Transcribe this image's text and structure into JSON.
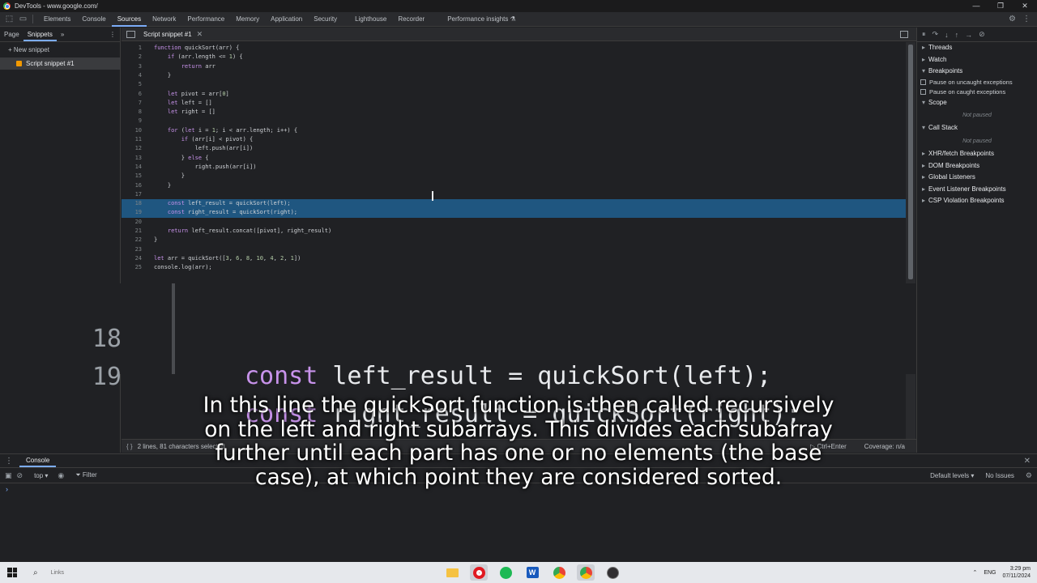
{
  "window": {
    "title": "DevTools - www.google.com/",
    "controls": [
      "—",
      "❐",
      "✕"
    ]
  },
  "maintabs": [
    "Elements",
    "Console",
    "Sources",
    "Network",
    "Performance",
    "Memory",
    "Application",
    "Security",
    "Lighthouse",
    "Recorder",
    "Performance insights ⚗"
  ],
  "navigator": {
    "tabs": [
      "Page",
      "Snippets"
    ],
    "more": "»",
    "new_snippet": "+ New snippet",
    "snippet": "Script snippet #1"
  },
  "editor": {
    "tab": "Script snippet #1",
    "close": "✕"
  },
  "code": [
    {
      "n": "1",
      "t": "function quickSort(arr) {"
    },
    {
      "n": "2",
      "t": "    if (arr.length <= 1) {"
    },
    {
      "n": "3",
      "t": "        return arr"
    },
    {
      "n": "4",
      "t": "    }"
    },
    {
      "n": "5",
      "t": ""
    },
    {
      "n": "6",
      "t": "    let pivot = arr[0]"
    },
    {
      "n": "7",
      "t": "    let left = []"
    },
    {
      "n": "8",
      "t": "    let right = []"
    },
    {
      "n": "9",
      "t": ""
    },
    {
      "n": "10",
      "t": "    for (let i = 1; i < arr.length; i++) {"
    },
    {
      "n": "11",
      "t": "        if (arr[i] < pivot) {"
    },
    {
      "n": "12",
      "t": "            left.push(arr[i])"
    },
    {
      "n": "13",
      "t": "        } else {"
    },
    {
      "n": "14",
      "t": "            right.push(arr[i])"
    },
    {
      "n": "15",
      "t": "        }"
    },
    {
      "n": "16",
      "t": "    }"
    },
    {
      "n": "17",
      "t": ""
    },
    {
      "n": "18",
      "t": "    const left_result = quickSort(left);"
    },
    {
      "n": "19",
      "t": "    const right_result = quickSort(right);"
    },
    {
      "n": "20",
      "t": ""
    },
    {
      "n": "21",
      "t": "    return left_result.concat([pivot], right_result)"
    },
    {
      "n": "22",
      "t": "}"
    },
    {
      "n": "23",
      "t": ""
    },
    {
      "n": "24",
      "t": "let arr = quickSort([3, 6, 8, 10, 4, 2, 1])"
    },
    {
      "n": "25",
      "t": "console.log(arr);"
    }
  ],
  "selected_lines": [
    "18",
    "19"
  ],
  "zoom": [
    {
      "n": "18",
      "kw": "const",
      "rest": " left_result = quickSort(left);"
    },
    {
      "n": "19",
      "kw": "const",
      "rest": " right_result = quickSort(right);"
    }
  ],
  "status": {
    "braces": "{ }",
    "selection": "2 lines, 81 characters selected",
    "run": "▷ Ctrl+Enter",
    "coverage": "Coverage: n/a"
  },
  "debugger": {
    "threads": "Threads",
    "watch": "Watch",
    "breakpoints": "Breakpoints",
    "pause_uncaught": "Pause on uncaught exceptions",
    "pause_caught": "Pause on caught exceptions",
    "scope": "Scope",
    "not_paused": "Not paused",
    "call_stack": "Call Stack",
    "xhr": "XHR/fetch Breakpoints",
    "dom": "DOM Breakpoints",
    "global": "Global Listeners",
    "event": "Event Listener Breakpoints",
    "csp": "CSP Violation Breakpoints"
  },
  "console": {
    "tab": "Console",
    "context": "top ▾",
    "filter": "Filter",
    "levels": "Default levels ▾",
    "issues": "No Issues",
    "prompt": "›"
  },
  "caption": "In this line the quickSort function is then called recursively on the left and right subarrays. This divides each subarray further until each part has one or no elements (the base case), at which point they are considered sorted.",
  "taskbar": {
    "search": "Links",
    "lang": "ENG",
    "time": "3:29 pm",
    "date": "07/11/2024"
  },
  "colors": {
    "selection": "#1f5680",
    "keyword": "#c792ea",
    "accent": "#7cacf8"
  }
}
